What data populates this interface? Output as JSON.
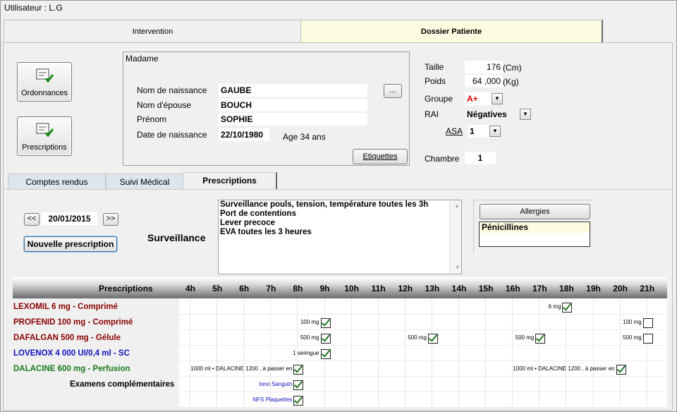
{
  "user": "Utilisateur :  L.G",
  "tabs": {
    "intervention": "Intervention",
    "dossier": "Dossier Patiente"
  },
  "buttons": {
    "ordonnances": "Ordonnances",
    "prescriptions": "Prescriptions",
    "etiquettes": "Etiquettes",
    "ellipsis": "...",
    "prev": "<<",
    "next": ">>",
    "nouvelle": "Nouvelle prescription",
    "allergies": "Allergies"
  },
  "patient": {
    "civilite": "Madame",
    "nom_naissance_label": "Nom de naissance",
    "nom_naissance": "GAUBE",
    "nom_epouse_label": "Nom d'épouse",
    "nom_epouse": "BOUCH",
    "prenom_label": "Prénom",
    "prenom": "SOPHIE",
    "ddn_label": "Date de naissance",
    "ddn": "22/10/1980",
    "age": "Age 34 ans"
  },
  "vitals": {
    "taille_label": "Taille",
    "taille": "176",
    "taille_unit": "(Cm)",
    "poids_label": "Poids",
    "poids": "64 ,000",
    "poids_unit": "(Kg)",
    "groupe_label": "Groupe",
    "groupe": "A+",
    "rai_label": "RAI",
    "rai": "Négatives",
    "asa_label": "ASA",
    "asa": "1",
    "chambre_label": "Chambre",
    "chambre": "1"
  },
  "subtabs": [
    "Comptes rendus",
    "Suivi Médical",
    "Prescriptions"
  ],
  "date": "20/01/2015",
  "surveillance_label": "Surveillance",
  "surveillance": [
    "Surveillance pouls, tension, température toutes les 3h",
    "Port de contentions",
    "Lever precoce",
    "EVA toutes les 3 heures"
  ],
  "allergy": "Pénicillines",
  "colors": {
    "red": "#8b0000",
    "blue": "#1010c0",
    "green": "#1b7a1b",
    "groupe": "#e00000"
  },
  "grid": {
    "header_label": "Prescriptions",
    "hours": [
      "4h",
      "5h",
      "6h",
      "7h",
      "8h",
      "9h",
      "10h",
      "11h",
      "12h",
      "13h",
      "14h",
      "15h",
      "16h",
      "17h",
      "18h",
      "19h",
      "20h",
      "21h"
    ],
    "rows": [
      {
        "name": "LEXOMIL  6 mg   -   Comprimé",
        "color": "red"
      },
      {
        "name": "PROFENID  100 mg   -   Comprimé",
        "color": "red"
      },
      {
        "name": "DAFALGAN  500 mg   -   Gélule",
        "color": "red"
      },
      {
        "name": "LOVENOX  4 000 UI/0,4 ml   -   SC",
        "color": "blue"
      },
      {
        "name": "DALACINE 600 mg    - Perfusion",
        "color": "green"
      },
      {
        "name": "Examens complémentaires",
        "color": "black"
      }
    ],
    "entries": [
      {
        "row": 0,
        "hour": 14,
        "dose": "6 mg",
        "checked": true
      },
      {
        "row": 1,
        "hour": 5,
        "dose": "100 mg",
        "checked": true
      },
      {
        "row": 1,
        "hour": 17,
        "dose": "100 mg",
        "checked": false
      },
      {
        "row": 2,
        "hour": 5,
        "dose": "500 mg",
        "checked": true
      },
      {
        "row": 2,
        "hour": 9,
        "dose": "500 mg",
        "checked": true
      },
      {
        "row": 2,
        "hour": 13,
        "dose": "500 mg",
        "checked": true
      },
      {
        "row": 2,
        "hour": 17,
        "dose": "500 mg",
        "checked": false
      },
      {
        "row": 3,
        "hour": 5,
        "dose": "1 seringue",
        "checked": true
      },
      {
        "row": 4,
        "hour": 4,
        "dose": "1000 ml • DALACINE 1200 , à passer en",
        "checked": true
      },
      {
        "row": 4,
        "hour": 16,
        "dose": "1000 ml • DALACINE 1200 , à passer en",
        "checked": true
      },
      {
        "row": 5,
        "hour": 4,
        "dose": "Iono Sanguin",
        "checked": true,
        "blue": true
      },
      {
        "row": 6,
        "hour": 4,
        "dose": "NFS Plaquettes",
        "checked": true,
        "blue": true
      }
    ]
  }
}
